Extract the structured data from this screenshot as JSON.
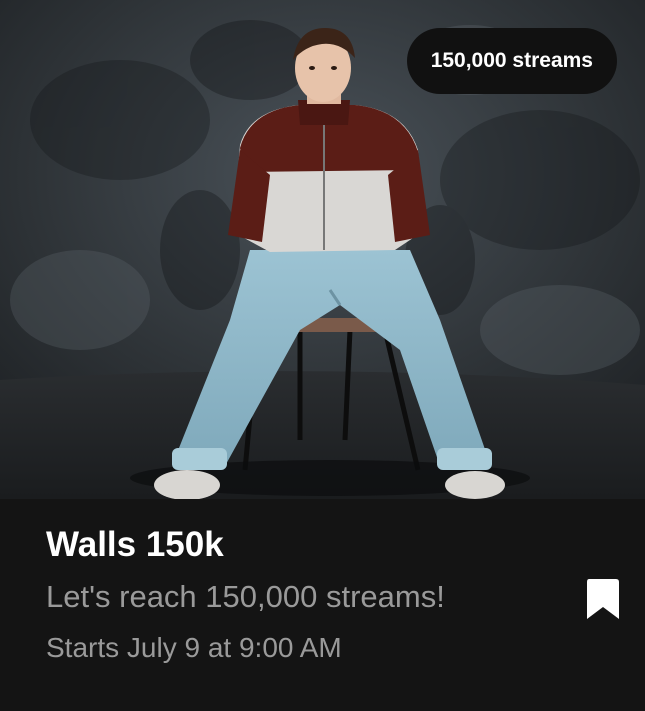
{
  "hero": {
    "image": "album-cover-photo",
    "badge_text": "150,000 streams"
  },
  "event": {
    "title": "Walls 150k",
    "subtitle": "Let's reach 150,000 streams!",
    "start": "Starts July 9 at 9:00 AM"
  },
  "icons": {
    "save": "bookmark-icon"
  },
  "colors": {
    "card_background": "#141414",
    "badge_background": "#111111",
    "title_text": "#ffffff",
    "secondary_text": "#9a9a9a"
  }
}
